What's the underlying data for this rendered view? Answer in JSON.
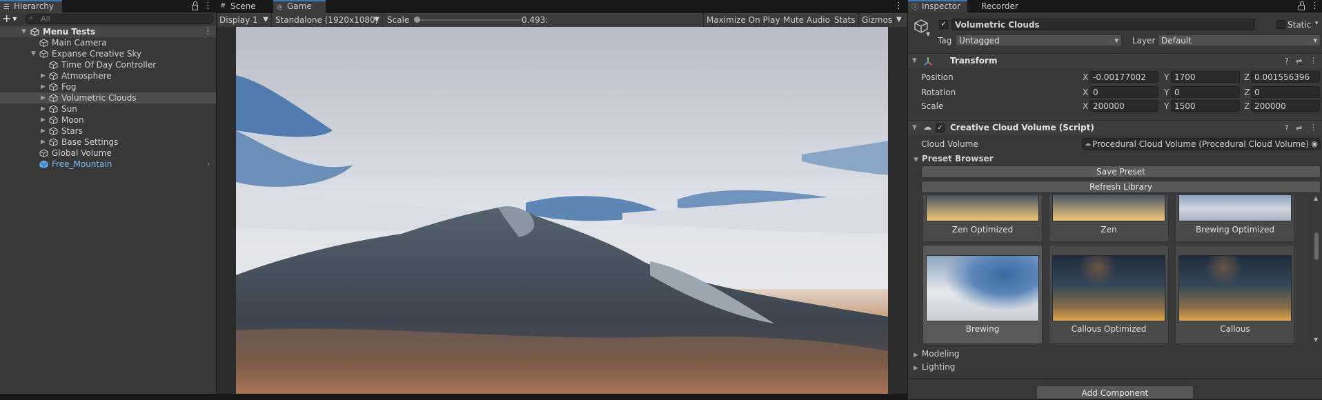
{
  "hierarchy": {
    "tab_label": "Hierarchy",
    "search_placeholder": "All",
    "add_label": "+",
    "scene_name": "Menu Tests",
    "items": [
      {
        "label": "Main Camera"
      },
      {
        "label": "Expanse Creative Sky"
      },
      {
        "label": "Time Of Day Controller"
      },
      {
        "label": "Atmosphere"
      },
      {
        "label": "Fog"
      },
      {
        "label": "Volumetric Clouds"
      },
      {
        "label": "Sun"
      },
      {
        "label": "Moon"
      },
      {
        "label": "Stars"
      },
      {
        "label": "Base Settings"
      },
      {
        "label": "Global Volume"
      },
      {
        "label": "Free_Mountain"
      }
    ]
  },
  "center": {
    "tabs": [
      {
        "label": "Scene"
      },
      {
        "label": "Game"
      }
    ],
    "toolbar": {
      "display": "Display 1",
      "resolution": "Standalone (1920x1080)",
      "scale_label": "Scale",
      "scale_value": "0.493:",
      "maximize": "Maximize On Play",
      "mute": "Mute Audio",
      "stats": "Stats",
      "gizmos": "Gizmos"
    }
  },
  "inspector": {
    "tabs": [
      {
        "label": "Inspector"
      },
      {
        "label": "Recorder"
      }
    ],
    "object_name": "Volumetric Clouds",
    "static_label": "Static",
    "tag_label": "Tag",
    "tag_value": "Untagged",
    "layer_label": "Layer",
    "layer_value": "Default",
    "transform": {
      "title": "Transform",
      "position_label": "Position",
      "rotation_label": "Rotation",
      "scale_label": "Scale",
      "axis": {
        "x": "X",
        "y": "Y",
        "z": "Z"
      },
      "position": {
        "x": "-0.00177002",
        "y": "1700",
        "z": "0.001556396"
      },
      "rotation": {
        "x": "0",
        "y": "0",
        "z": "0"
      },
      "scale": {
        "x": "200000",
        "y": "1500",
        "z": "200000"
      }
    },
    "script": {
      "title": "Creative Cloud Volume (Script)",
      "cloud_volume_label": "Cloud Volume",
      "cloud_volume_value": "Procedural Cloud Volume (Procedural Cloud Volume)",
      "preset_browser_label": "Preset Browser",
      "save_preset": "Save Preset",
      "refresh_library": "Refresh Library",
      "presets_top": [
        {
          "label": "Zen Optimized"
        },
        {
          "label": "Zen"
        },
        {
          "label": "Brewing Optimized"
        }
      ],
      "presets": [
        {
          "label": "Brewing"
        },
        {
          "label": "Callous Optimized"
        },
        {
          "label": "Callous"
        }
      ]
    },
    "modeling_label": "Modeling",
    "lighting_label": "Lighting",
    "add_component": "Add Component"
  },
  "colors": {
    "panel_bg": "#383838",
    "selection": "#4d4d4d",
    "accent_blue": "#3a79bb",
    "prefab_blue": "#7cb8f3"
  }
}
